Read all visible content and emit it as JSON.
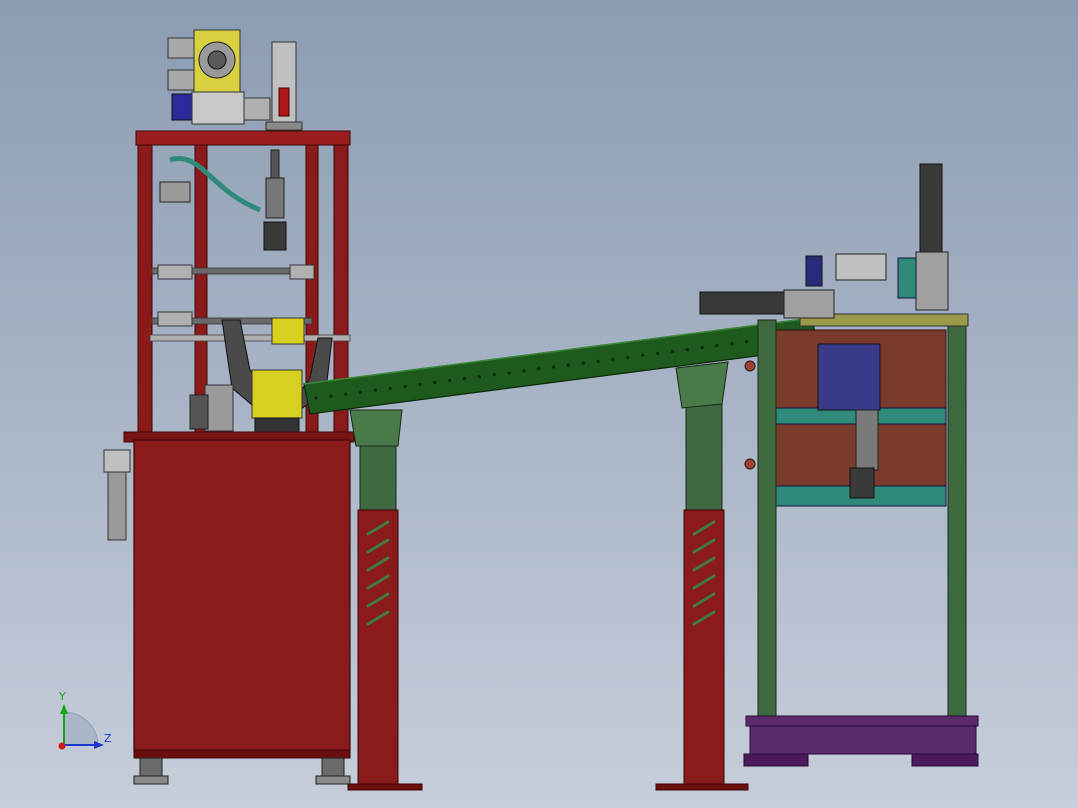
{
  "viewport": {
    "background_top": "#8c9cb3",
    "background_bottom": "#c6ceda"
  },
  "colors": {
    "frame_red": "#8b1a1a",
    "frame_red_dark": "#5a0d0d",
    "conveyor_green": "#1e5a1e",
    "leg_green": "#3f6a3f",
    "cabinet_maroon": "#7a3a2c",
    "base_purple": "#5a2a6a",
    "cylinder_gray": "#7a7a7a",
    "clamp_yellow": "#d8d020",
    "teal": "#2f8a7a",
    "blue_block": "#3a3a8a"
  },
  "triad": {
    "y_label": "Y",
    "z_label": "Z",
    "y_color": "#1aa01a",
    "z_color": "#1a3ad0",
    "x_color": "#d01a1a"
  }
}
